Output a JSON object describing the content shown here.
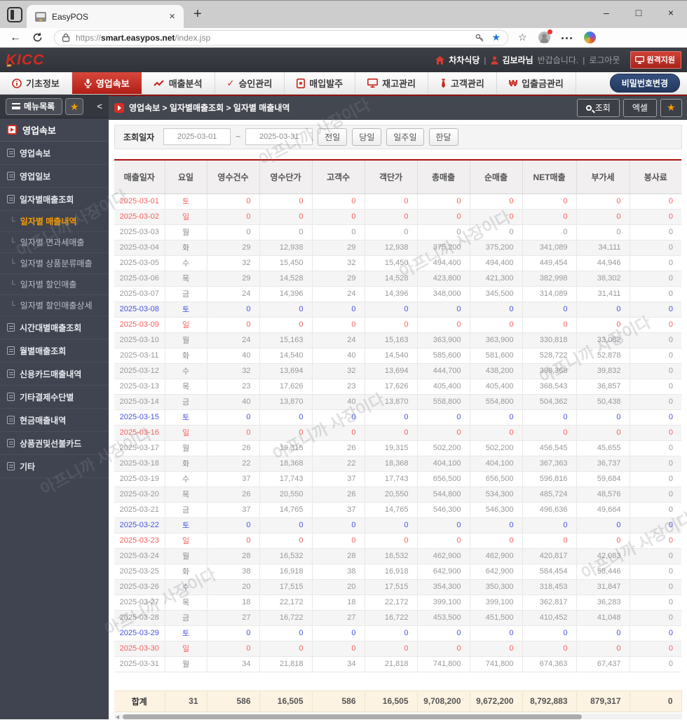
{
  "browser": {
    "tab_title": "EasyPOS",
    "tab_close": "×",
    "new_tab": "+",
    "window": {
      "minimize": "–",
      "maximize": "□",
      "close": "×"
    },
    "back_arrow": "←",
    "url_scheme": "https://",
    "url_host": "smart.easypos.net",
    "url_path": "/index.jsp",
    "bookmark_star": "★",
    "favorites_star": "☆"
  },
  "topbar": {
    "logo": "KICC",
    "store_name": "차차식당",
    "sep": "|",
    "user_name": "김보라님",
    "greeting": "반갑습니다.",
    "logout": "로그아웃",
    "remote_support": "원격지원"
  },
  "nav": {
    "items": [
      {
        "label": "기초정보",
        "icon": "info-icon"
      },
      {
        "label": "영업속보",
        "icon": "mic-icon",
        "active": true
      },
      {
        "label": "매출분석",
        "icon": "chart-icon"
      },
      {
        "label": "승인관리",
        "icon": "check-icon"
      },
      {
        "label": "매입발주",
        "icon": "purchase-icon"
      },
      {
        "label": "재고관리",
        "icon": "monitor-icon"
      },
      {
        "label": "고객관리",
        "icon": "tie-icon"
      },
      {
        "label": "입출금관리",
        "icon": "won-icon"
      }
    ],
    "check_glyph": "✓",
    "won_glyph": "₩",
    "password_change": "비밀번호변경"
  },
  "sidebar": {
    "menu_button": "메뉴목록",
    "star": "★",
    "collapse": "<",
    "section_title": "영업속보",
    "sub_prefix": "└",
    "items": [
      {
        "label": "영업속보",
        "type": "top"
      },
      {
        "label": "영업일보",
        "type": "top"
      },
      {
        "label": "일자별매출조회",
        "type": "top"
      },
      {
        "label": "일자별 매출내역",
        "type": "sub",
        "active": true
      },
      {
        "label": "일자별 면과세매출",
        "type": "sub"
      },
      {
        "label": "일자별 상품분류매출",
        "type": "sub"
      },
      {
        "label": "일자별 할인매출",
        "type": "sub"
      },
      {
        "label": "일자별 할인매출상세",
        "type": "sub"
      },
      {
        "label": "시간대별매출조회",
        "type": "top"
      },
      {
        "label": "월별매출조회",
        "type": "top"
      },
      {
        "label": "신용카드매출내역",
        "type": "top"
      },
      {
        "label": "기타결제수단별",
        "type": "top"
      },
      {
        "label": "현금매출내역",
        "type": "top"
      },
      {
        "label": "상품권및선불카드",
        "type": "top"
      },
      {
        "label": "기타",
        "type": "top"
      }
    ]
  },
  "breadcrumb": {
    "path": "영업속보 > 일자별매출조회 > 일자별 매출내역",
    "search_button": "조회",
    "excel_button": "엑셀",
    "star": "★"
  },
  "filter": {
    "label": "조회일자",
    "date_from": "2025-03-01",
    "tilde": "~",
    "date_to": "2025-03-31",
    "presets": [
      "전일",
      "당일",
      "일주일",
      "한달"
    ]
  },
  "table": {
    "headers": [
      "매출일자",
      "요일",
      "영수건수",
      "영수단가",
      "고객수",
      "객단가",
      "총매출",
      "순매출",
      "NET매출",
      "부가세",
      "봉사료"
    ],
    "rows": [
      {
        "date": "2025-03-01",
        "day": "토",
        "color": "red",
        "values": [
          "0",
          "0",
          "0",
          "0",
          "0",
          "0",
          "0",
          "0",
          "0"
        ]
      },
      {
        "date": "2025-03-02",
        "day": "일",
        "color": "red",
        "values": [
          "0",
          "0",
          "0",
          "0",
          "0",
          "0",
          "0",
          "0",
          "0"
        ]
      },
      {
        "date": "2025-03-03",
        "day": "월",
        "color": "",
        "values": [
          "0",
          "0",
          "0",
          "0",
          "0",
          "0",
          "0",
          "0",
          "0"
        ]
      },
      {
        "date": "2025-03-04",
        "day": "화",
        "color": "",
        "values": [
          "29",
          "12,938",
          "29",
          "12,938",
          "375,200",
          "375,200",
          "341,089",
          "34,111",
          "0"
        ]
      },
      {
        "date": "2025-03-05",
        "day": "수",
        "color": "",
        "values": [
          "32",
          "15,450",
          "32",
          "15,450",
          "494,400",
          "494,400",
          "449,454",
          "44,946",
          "0"
        ]
      },
      {
        "date": "2025-03-06",
        "day": "목",
        "color": "",
        "values": [
          "29",
          "14,528",
          "29",
          "14,528",
          "423,800",
          "421,300",
          "382,998",
          "38,302",
          "0"
        ]
      },
      {
        "date": "2025-03-07",
        "day": "금",
        "color": "",
        "values": [
          "24",
          "14,396",
          "24",
          "14,396",
          "348,000",
          "345,500",
          "314,089",
          "31,411",
          "0"
        ]
      },
      {
        "date": "2025-03-08",
        "day": "토",
        "color": "blue",
        "values": [
          "0",
          "0",
          "0",
          "0",
          "0",
          "0",
          "0",
          "0",
          "0"
        ]
      },
      {
        "date": "2025-03-09",
        "day": "일",
        "color": "red",
        "values": [
          "0",
          "0",
          "0",
          "0",
          "0",
          "0",
          "0",
          "0",
          "0"
        ]
      },
      {
        "date": "2025-03-10",
        "day": "월",
        "color": "",
        "values": [
          "24",
          "15,163",
          "24",
          "15,163",
          "363,900",
          "363,900",
          "330,818",
          "33,082",
          "0"
        ]
      },
      {
        "date": "2025-03-11",
        "day": "화",
        "color": "",
        "values": [
          "40",
          "14,540",
          "40",
          "14,540",
          "585,600",
          "581,600",
          "528,722",
          "52,878",
          "0"
        ]
      },
      {
        "date": "2025-03-12",
        "day": "수",
        "color": "",
        "values": [
          "32",
          "13,694",
          "32",
          "13,694",
          "444,700",
          "438,200",
          "398,368",
          "39,832",
          "0"
        ]
      },
      {
        "date": "2025-03-13",
        "day": "목",
        "color": "",
        "values": [
          "23",
          "17,626",
          "23",
          "17,626",
          "405,400",
          "405,400",
          "368,543",
          "36,857",
          "0"
        ]
      },
      {
        "date": "2025-03-14",
        "day": "금",
        "color": "",
        "values": [
          "40",
          "13,870",
          "40",
          "13,870",
          "558,800",
          "554,800",
          "504,362",
          "50,438",
          "0"
        ]
      },
      {
        "date": "2025-03-15",
        "day": "토",
        "color": "blue",
        "values": [
          "0",
          "0",
          "0",
          "0",
          "0",
          "0",
          "0",
          "0",
          "0"
        ]
      },
      {
        "date": "2025-03-16",
        "day": "일",
        "color": "red",
        "values": [
          "0",
          "0",
          "0",
          "0",
          "0",
          "0",
          "0",
          "0",
          "0"
        ]
      },
      {
        "date": "2025-03-17",
        "day": "월",
        "color": "",
        "values": [
          "26",
          "19,315",
          "26",
          "19,315",
          "502,200",
          "502,200",
          "456,545",
          "45,655",
          "0"
        ]
      },
      {
        "date": "2025-03-18",
        "day": "화",
        "color": "",
        "values": [
          "22",
          "18,368",
          "22",
          "18,368",
          "404,100",
          "404,100",
          "367,363",
          "36,737",
          "0"
        ]
      },
      {
        "date": "2025-03-19",
        "day": "수",
        "color": "",
        "values": [
          "37",
          "17,743",
          "37",
          "17,743",
          "656,500",
          "656,500",
          "596,816",
          "59,684",
          "0"
        ]
      },
      {
        "date": "2025-03-20",
        "day": "목",
        "color": "",
        "values": [
          "26",
          "20,550",
          "26",
          "20,550",
          "544,800",
          "534,300",
          "485,724",
          "48,576",
          "0"
        ]
      },
      {
        "date": "2025-03-21",
        "day": "금",
        "color": "",
        "values": [
          "37",
          "14,765",
          "37",
          "14,765",
          "546,300",
          "546,300",
          "496,636",
          "49,664",
          "0"
        ]
      },
      {
        "date": "2025-03-22",
        "day": "토",
        "color": "blue",
        "values": [
          "0",
          "0",
          "0",
          "0",
          "0",
          "0",
          "0",
          "0",
          "0"
        ]
      },
      {
        "date": "2025-03-23",
        "day": "일",
        "color": "red",
        "values": [
          "0",
          "0",
          "0",
          "0",
          "0",
          "0",
          "0",
          "0",
          "0"
        ]
      },
      {
        "date": "2025-03-24",
        "day": "월",
        "color": "",
        "values": [
          "28",
          "16,532",
          "28",
          "16,532",
          "462,900",
          "462,900",
          "420,817",
          "42,083",
          "0"
        ]
      },
      {
        "date": "2025-03-25",
        "day": "화",
        "color": "",
        "values": [
          "38",
          "16,918",
          "38",
          "16,918",
          "642,900",
          "642,900",
          "584,454",
          "58,446",
          "0"
        ]
      },
      {
        "date": "2025-03-26",
        "day": "수",
        "color": "",
        "values": [
          "20",
          "17,515",
          "20",
          "17,515",
          "354,300",
          "350,300",
          "318,453",
          "31,847",
          "0"
        ]
      },
      {
        "date": "2025-03-27",
        "day": "목",
        "color": "",
        "values": [
          "18",
          "22,172",
          "18",
          "22,172",
          "399,100",
          "399,100",
          "362,817",
          "36,283",
          "0"
        ]
      },
      {
        "date": "2025-03-28",
        "day": "금",
        "color": "",
        "values": [
          "27",
          "16,722",
          "27",
          "16,722",
          "453,500",
          "451,500",
          "410,452",
          "41,048",
          "0"
        ]
      },
      {
        "date": "2025-03-29",
        "day": "토",
        "color": "blue",
        "values": [
          "0",
          "0",
          "0",
          "0",
          "0",
          "0",
          "0",
          "0",
          "0"
        ]
      },
      {
        "date": "2025-03-30",
        "day": "일",
        "color": "red",
        "values": [
          "0",
          "0",
          "0",
          "0",
          "0",
          "0",
          "0",
          "0",
          "0"
        ]
      },
      {
        "date": "2025-03-31",
        "day": "월",
        "color": "",
        "values": [
          "34",
          "21,818",
          "34",
          "21,818",
          "741,800",
          "741,800",
          "674,363",
          "67,437",
          "0"
        ]
      }
    ],
    "total": [
      "합계",
      "31",
      "586",
      "16,505",
      "586",
      "16,505",
      "9,708,200",
      "9,672,200",
      "8,792,883",
      "879,317",
      "0"
    ]
  },
  "watermark": "아프니까 사장이다",
  "colors": {
    "accent_red": "#c8281e",
    "active_orange": "#f59b00",
    "weekend_blue": "#4753e0",
    "holiday_red": "#f95f5b",
    "total_bg": "#fcf3e3"
  }
}
